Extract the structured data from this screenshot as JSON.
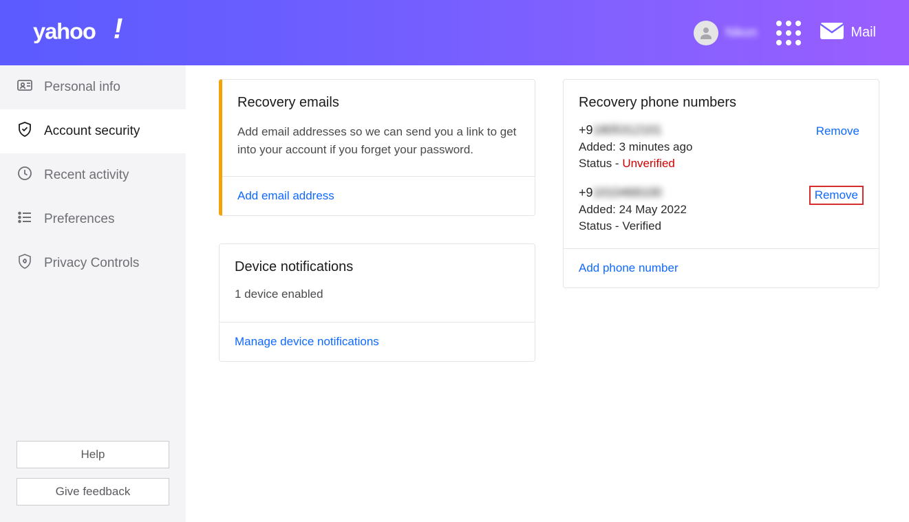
{
  "header": {
    "username": "Nikon",
    "mail_label": "Mail"
  },
  "sidebar": {
    "items": [
      {
        "key": "personal-info",
        "label": "Personal info"
      },
      {
        "key": "account-security",
        "label": "Account security"
      },
      {
        "key": "recent-activity",
        "label": "Recent activity"
      },
      {
        "key": "preferences",
        "label": "Preferences"
      },
      {
        "key": "privacy-controls",
        "label": "Privacy Controls"
      }
    ],
    "help_label": "Help",
    "feedback_label": "Give feedback"
  },
  "recovery_emails": {
    "title": "Recovery emails",
    "description": "Add email addresses so we can send you a link to get into your account if you forget your password.",
    "action": "Add email address"
  },
  "recovery_phones": {
    "title": "Recovery phone numbers",
    "phones": [
      {
        "prefix": "+9",
        "rest": "1805312101",
        "added_label": "Added:",
        "added_value": "3 minutes ago",
        "status_label": "Status -",
        "status_value": "Unverified",
        "verified": false,
        "remove": "Remove"
      },
      {
        "prefix": "+9",
        "rest": "1010468100",
        "added_label": "Added:",
        "added_value": "24 May 2022",
        "status_label": "Status -",
        "status_value": "Verified",
        "verified": true,
        "remove": "Remove"
      }
    ],
    "action": "Add phone number"
  },
  "device_notifications": {
    "title": "Device notifications",
    "count_text": "1 device enabled",
    "action": "Manage device notifications"
  }
}
